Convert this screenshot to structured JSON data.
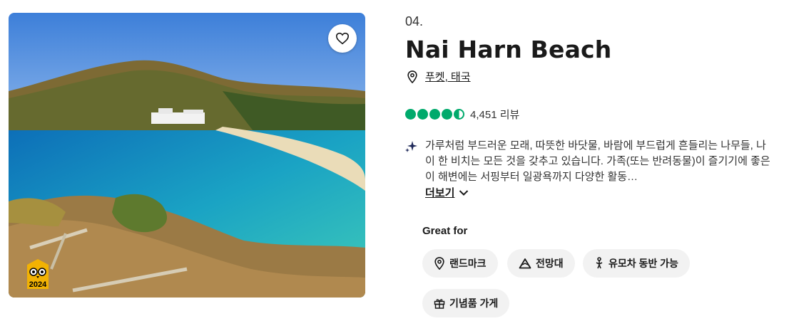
{
  "attraction": {
    "rank": "04.",
    "name": "Nai Harn Beach",
    "location": "푸켓, 태국",
    "rating": 4.5,
    "review_count": "4,451 리뷰",
    "description": "가루처럼 부드러운 모래, 따뜻한 바닷물, 바람에 부드럽게 흔들리는 나무들, 나이 한 비치는 모든 것을 갖추고 있습니다. 가족(또는 반려동물)이 즐기기에 좋은 이 해변에는 서핑부터 일광욕까지 다양한 활동…",
    "more_label": "더보기",
    "badge_year": "2024"
  },
  "great_for": {
    "heading": "Great for",
    "tags": [
      {
        "label": "랜드마크",
        "icon": "map-pin-icon"
      },
      {
        "label": "전망대",
        "icon": "mountain-icon"
      },
      {
        "label": "유모차 동반 가능",
        "icon": "stroller-icon"
      },
      {
        "label": "기념품 가게",
        "icon": "gift-icon"
      }
    ]
  },
  "colors": {
    "rating_green": "#00aa6c",
    "chip_bg": "#f2f2f2",
    "badge_yellow": "#f2b203"
  }
}
